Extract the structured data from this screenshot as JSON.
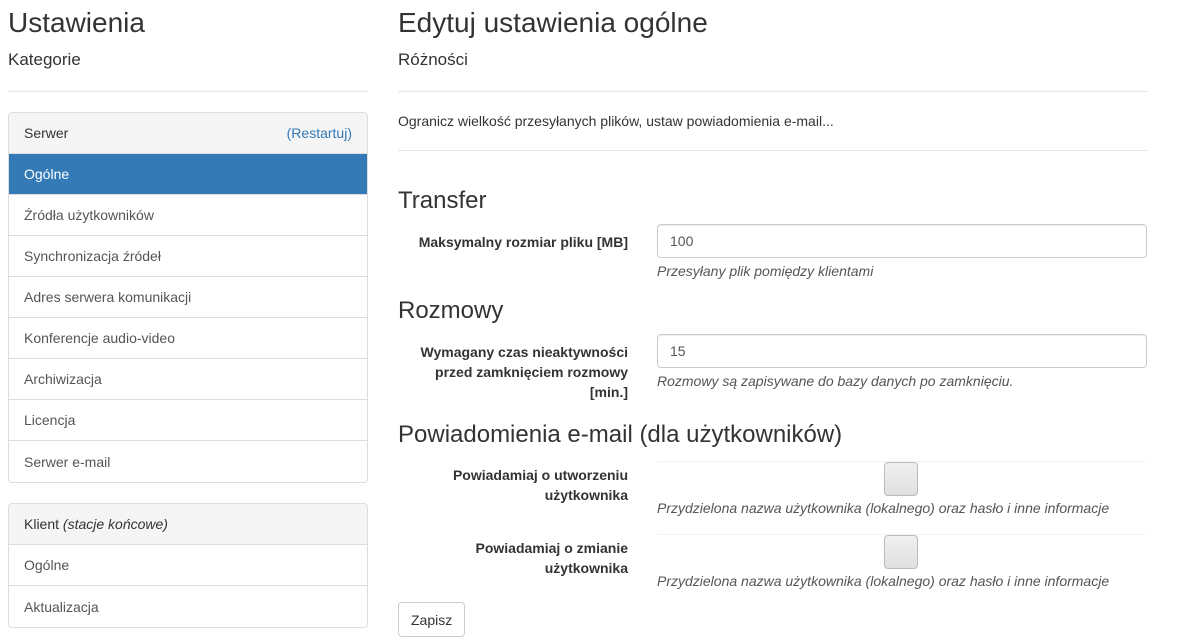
{
  "sidebar": {
    "title": "Ustawienia",
    "subtitle": "Kategorie",
    "server_panel": {
      "heading": "Serwer",
      "restart_label": "(Restartuj)",
      "items": [
        {
          "label": "Ogólne",
          "active": true
        },
        {
          "label": "Źródła użytkowników"
        },
        {
          "label": "Synchronizacja źródeł"
        },
        {
          "label": "Adres serwera komunikacji"
        },
        {
          "label": "Konferencje audio-video"
        },
        {
          "label": "Archiwizacja"
        },
        {
          "label": "Licencja"
        },
        {
          "label": "Serwer e-mail"
        }
      ]
    },
    "client_panel": {
      "heading": "Klient",
      "heading_note": "(stacje końcowe)",
      "items": [
        {
          "label": "Ogólne"
        },
        {
          "label": "Aktualizacja"
        }
      ]
    }
  },
  "main": {
    "title": "Edytuj ustawienia ogólne",
    "subtitle": "Różności",
    "description": "Ogranicz wielkość przesyłanych plików, ustaw powiadomienia e-mail...",
    "transfer": {
      "title": "Transfer",
      "max_file_label": "Maksymalny rozmiar pliku [MB]",
      "max_file_value": "100",
      "max_file_help": "Przesyłany plik pomiędzy klientami"
    },
    "conversations": {
      "title": "Rozmowy",
      "inactivity_label_1": "Wymagany czas nieaktywności",
      "inactivity_label_2": "przed zamknięciem rozmowy",
      "inactivity_label_3": "[min.]",
      "inactivity_value": "15",
      "inactivity_help": "Rozmowy są zapisywane do bazy danych po zamknięciu."
    },
    "notifications": {
      "title": "Powiadomienia e-mail (dla użytkowników)",
      "on_create_label_1": "Powiadamiaj o utworzeniu",
      "on_create_label_2": "użytkownika",
      "on_create_help": "Przydzielona nazwa użytkownika (lokalnego) oraz hasło i inne informacje",
      "on_change_label_1": "Powiadamiaj o zmianie",
      "on_change_label_2": "użytkownika",
      "on_change_help": "Przydzielona nazwa użytkownika (lokalnego) oraz hasło i inne informacje"
    },
    "save_label": "Zapisz"
  },
  "colors": {
    "accent": "#337ab7"
  }
}
